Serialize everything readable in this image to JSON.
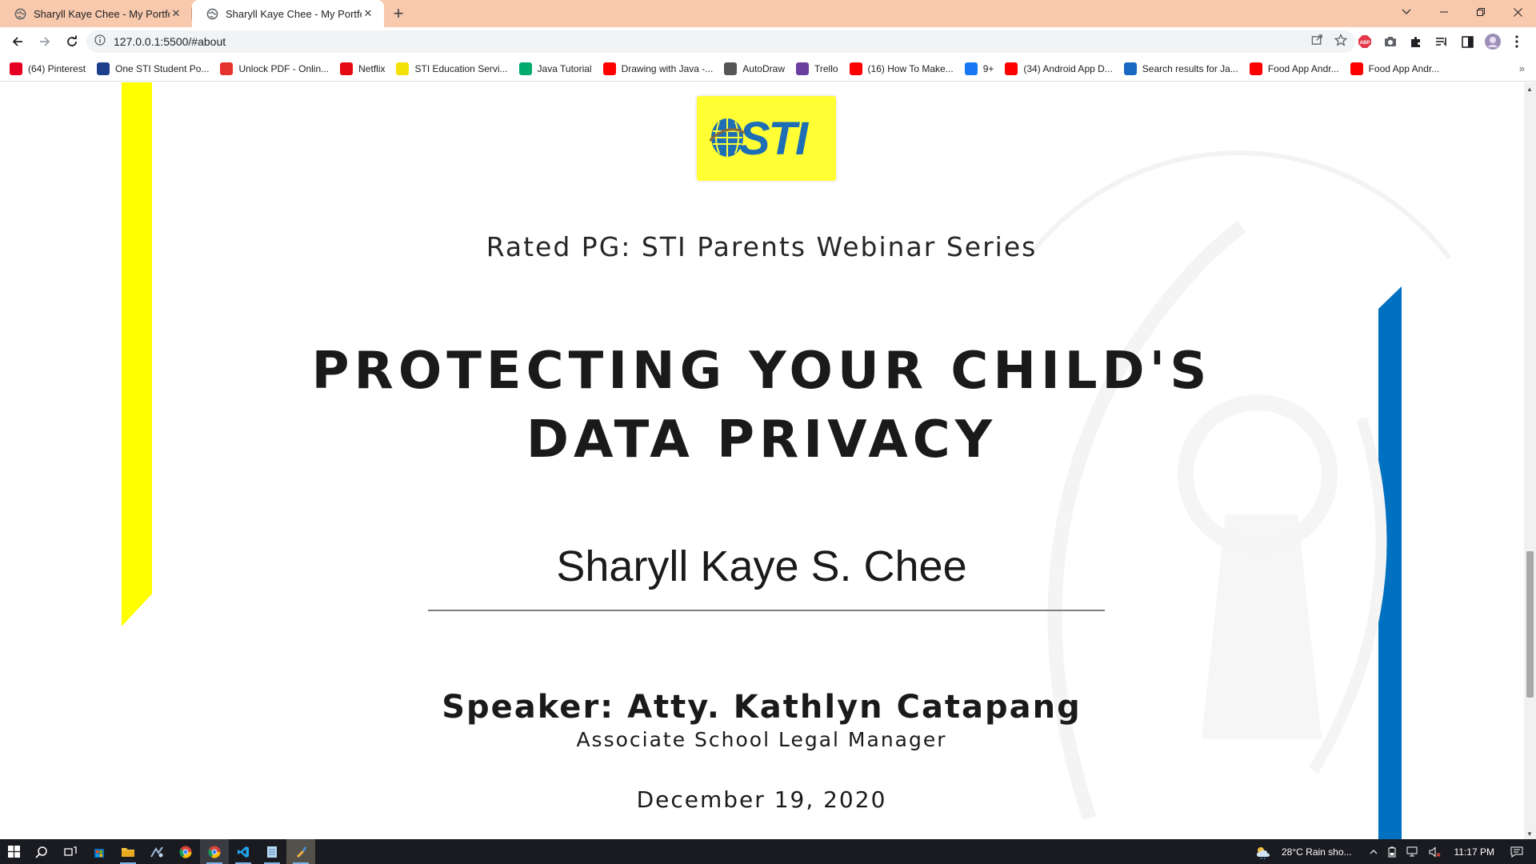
{
  "browser": {
    "tabs": [
      {
        "title": "Sharyll Kaye Chee - My Portfolio",
        "active": false
      },
      {
        "title": "Sharyll Kaye Chee - My Portfolio",
        "active": true
      }
    ],
    "url": "127.0.0.1:5500/#about",
    "bookmarks": [
      {
        "label": "(64) Pinterest",
        "icon": "pinterest-icon",
        "color": "#e60023"
      },
      {
        "label": "One STI Student Po...",
        "icon": "sti-portal-icon",
        "color": "#1d3f8c"
      },
      {
        "label": "Unlock PDF - Onlin...",
        "icon": "smallpdf-icon",
        "color": "#e5322d"
      },
      {
        "label": "Netflix",
        "icon": "netflix-icon",
        "color": "#e50914"
      },
      {
        "label": "STI Education Servi...",
        "icon": "sti-icon",
        "color": "#f5e10a"
      },
      {
        "label": "Java Tutorial",
        "icon": "w3schools-icon",
        "color": "#04aa6d"
      },
      {
        "label": "Drawing with Java -...",
        "icon": "youtube-icon",
        "color": "#ff0000"
      },
      {
        "label": "AutoDraw",
        "icon": "autodraw-icon",
        "color": "#555555"
      },
      {
        "label": "Trello",
        "icon": "trello-icon",
        "color": "#6b3fa0"
      },
      {
        "label": "(16) How To Make...",
        "icon": "youtube-icon",
        "color": "#ff0000"
      },
      {
        "label": "9+",
        "icon": "facebook-icon",
        "color": "#1877f2"
      },
      {
        "label": "(34) Android App D...",
        "icon": "youtube-icon",
        "color": "#ff0000"
      },
      {
        "label": "Search results for Ja...",
        "icon": "vuetify-icon",
        "color": "#1867c0"
      },
      {
        "label": "Food App Andr...",
        "icon": "youtube-icon",
        "color": "#ff0000"
      },
      {
        "label": "Food App Andr...",
        "icon": "youtube-icon",
        "color": "#ff0000"
      }
    ]
  },
  "slide": {
    "logo_text": "STI",
    "series": "Rated PG: STI Parents Webinar Series",
    "headline_line1": "PROTECTING YOUR CHILD'S",
    "headline_line2": "DATA PRIVACY",
    "student_name": "Sharyll Kaye S. Chee",
    "speaker": "Speaker: Atty. Kathlyn Catapang",
    "role": "Associate School Legal Manager",
    "date": "December 19, 2020",
    "colors": {
      "yellow_bar": "#ffff00",
      "blue_bar": "#0070c0",
      "logo_bg": "#ffff33",
      "logo_text": "#1e6eb5"
    }
  },
  "taskbar": {
    "weather": "28°C  Rain sho...",
    "time": "11:17 PM"
  }
}
